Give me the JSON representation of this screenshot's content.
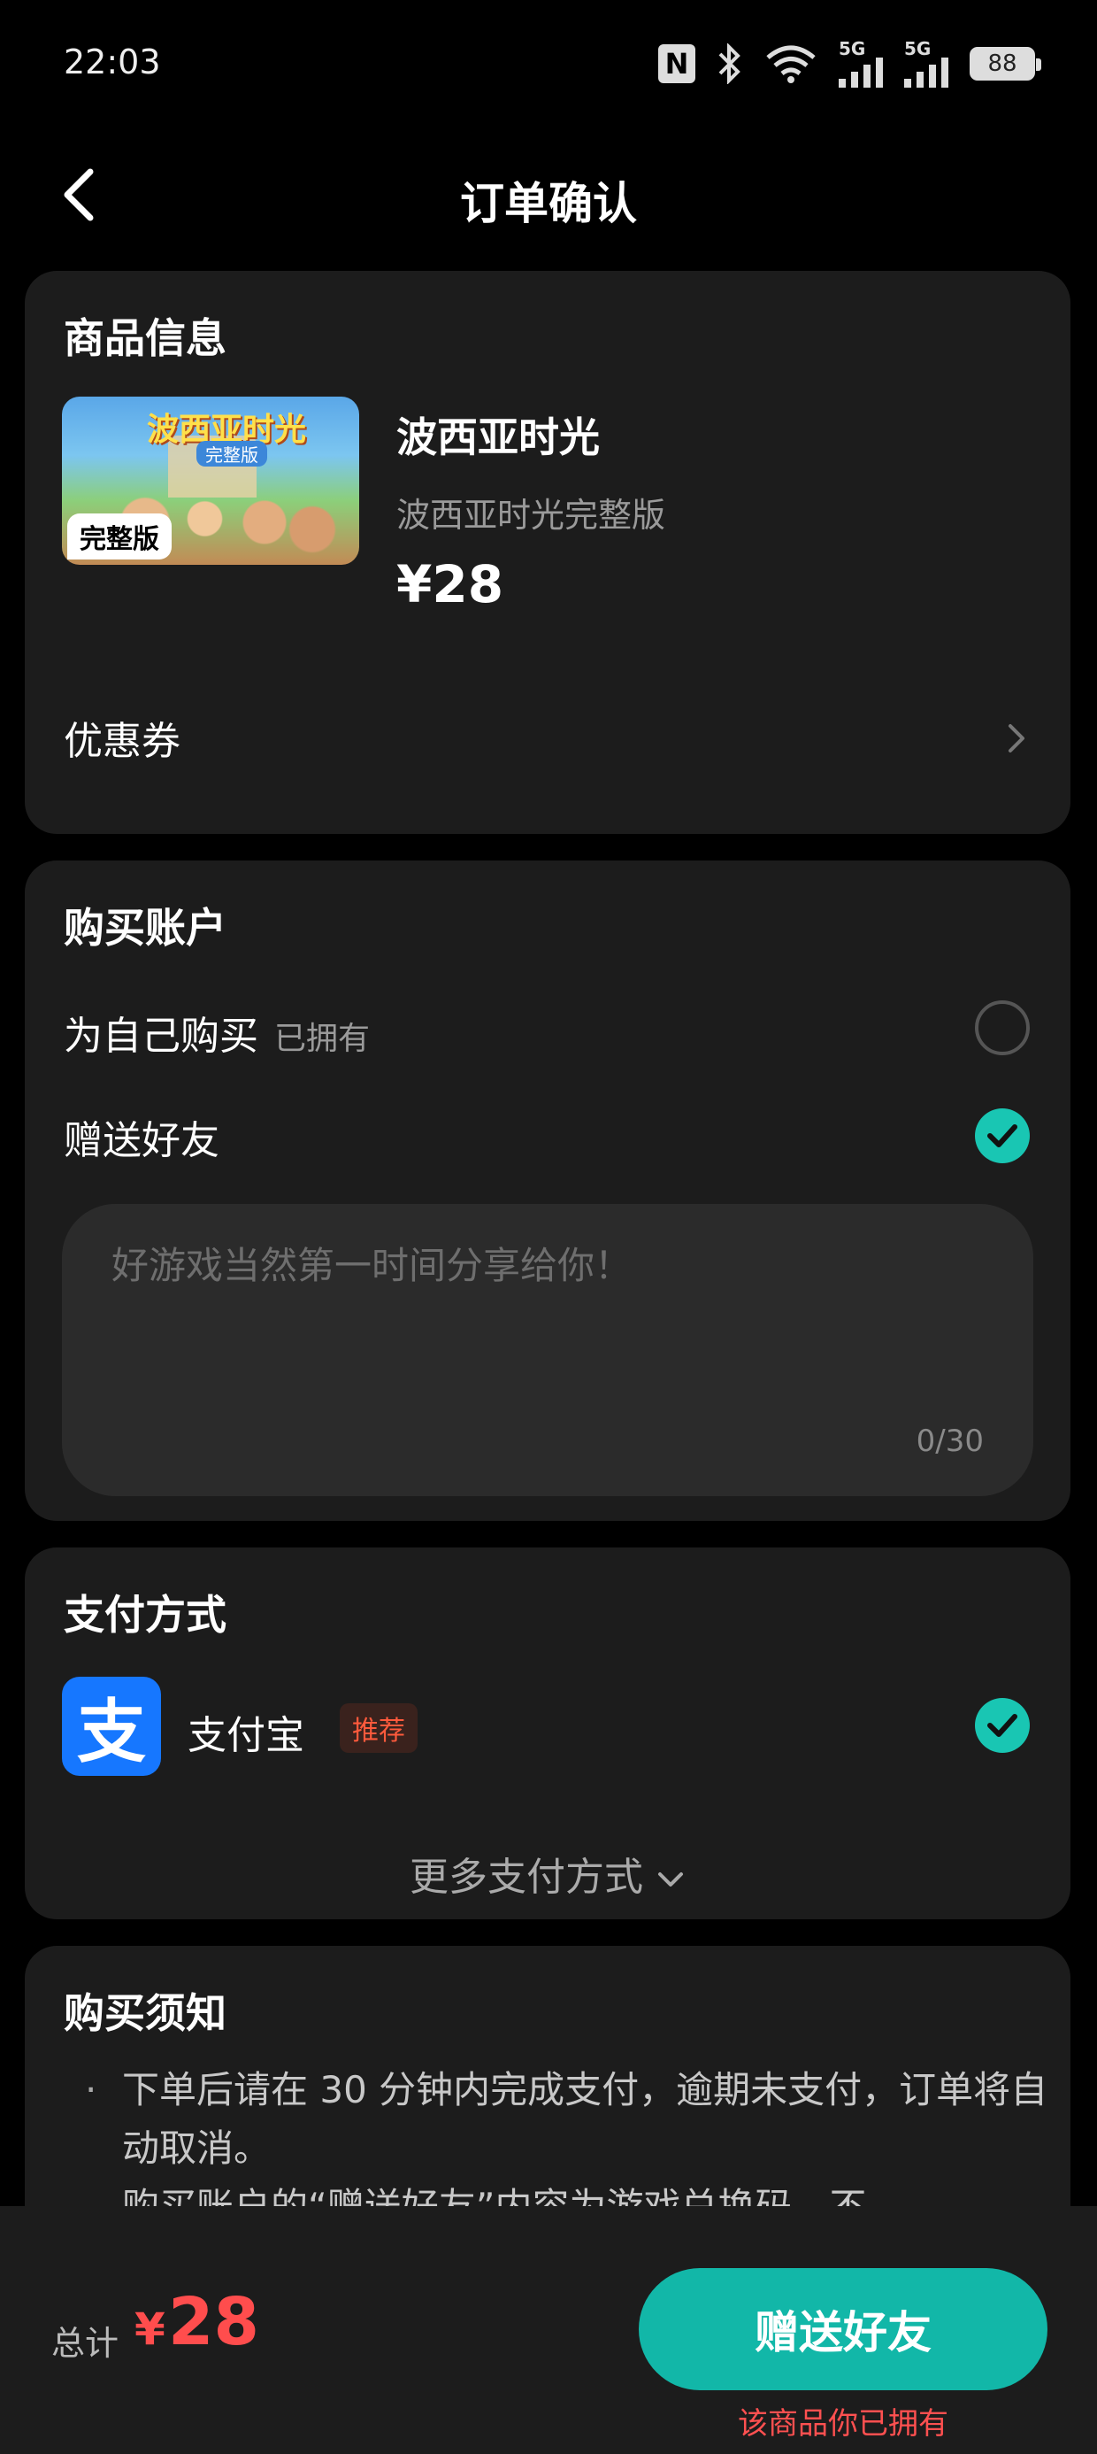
{
  "status_bar": {
    "time": "22:03",
    "nfc_icon": "N",
    "network_1": "5G",
    "network_2": "5G",
    "battery": "88"
  },
  "header": {
    "title": "订单确认"
  },
  "product": {
    "section_title": "商品信息",
    "thumb_title": "波西亚时光",
    "thumb_subtitle": "完整版",
    "thumb_badge": "完整版",
    "name": "波西亚时光",
    "edition": "波西亚时光完整版",
    "price": "¥28",
    "coupon_label": "优惠券"
  },
  "account": {
    "section_title": "购买账户",
    "self_label": "为自己购买",
    "self_owned": "已拥有",
    "self_selected": false,
    "gift_label": "赠送好友",
    "gift_selected": true,
    "message_placeholder": "好游戏当然第一时间分享给你！",
    "message_counter": "0/30"
  },
  "payment": {
    "section_title": "支付方式",
    "alipay_icon_char": "支",
    "method_name": "支付宝",
    "recommend_tag": "推荐",
    "more_methods": "更多支付方式"
  },
  "notice": {
    "section_title": "购买须知",
    "bullet": "·",
    "item_1": "下单后请在 30 分钟内完成支付，逾期未支付，订单将自动取消。",
    "item_2": "购买账户的“赠送好友”内容为游戏兑换码，不"
  },
  "bottom": {
    "total_label": "总计",
    "currency": "¥",
    "total_value": "28",
    "action_button": "赠送好友",
    "owned_note": "该商品你已拥有"
  },
  "colors": {
    "accent": "#12b7a8",
    "price_red": "#ff4d4d",
    "alipay_blue": "#1677ff",
    "card_bg": "#1c1c1c"
  }
}
